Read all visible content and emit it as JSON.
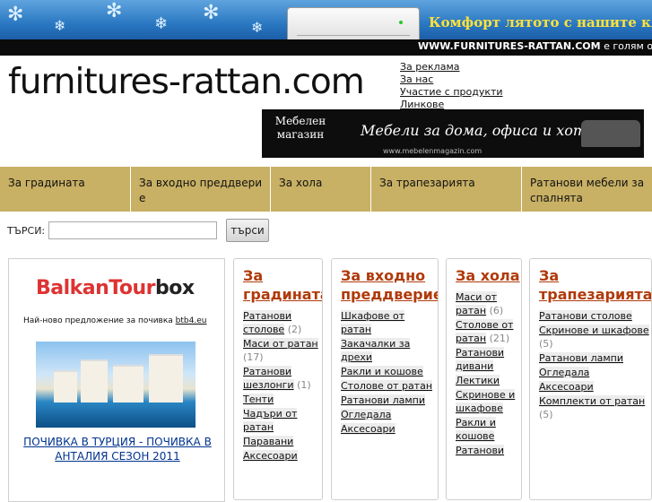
{
  "banner": {
    "promo_text": "Комфорт лятото с нашите клим",
    "site_bold": "WWW.FURNITURES-RATTAN.COM",
    "site_rest": " е голям онлай"
  },
  "header": {
    "logo_text": "furnitures-rattan.com",
    "top_links": [
      "За реклама",
      "За нас",
      "Участие с продукти",
      "Линкове"
    ]
  },
  "ad2": {
    "badge": "Мебелен магазин",
    "slogan": "Мебели за дома, офиса и хотела",
    "url": "www.mebelenmagazin.com"
  },
  "nav": {
    "tabs": [
      "За градината",
      "За входно преддвери е",
      "За хола",
      "За трапезарията",
      "Ратанови мебели за спалнята"
    ]
  },
  "search": {
    "label": "ТЪРСИ:",
    "value": "",
    "button": "търси"
  },
  "ad_box": {
    "brand_a": "BalkanTour",
    "brand_b": "box",
    "line_text": "Най-ново предложение за почивка ",
    "line_link": "btb4.eu",
    "caption": "ПОЧИВКА В ТУРЦИЯ - ПОЧИВКА В АНТАЛИЯ СЕЗОН 2011"
  },
  "columns": [
    {
      "title": "За градината",
      "items": [
        {
          "label": "Ратанови столове",
          "count": "(2)"
        },
        {
          "label": "Маси от ратан",
          "count": "(17)"
        },
        {
          "label": "Ратанови шезлонги",
          "count": "(1)"
        },
        {
          "label": "Тенти",
          "count": ""
        },
        {
          "label": "Чадъри от ратан",
          "count": ""
        },
        {
          "label": "Паравани",
          "count": ""
        },
        {
          "label": "Аксесоари",
          "count": ""
        }
      ]
    },
    {
      "title": "За входно преддверие",
      "items": [
        {
          "label": "Шкафове от ратан",
          "count": ""
        },
        {
          "label": "Закачалки за дрехи",
          "count": ""
        },
        {
          "label": "Ракли и кошове",
          "count": ""
        },
        {
          "label": "Столове от ратан",
          "count": ""
        },
        {
          "label": "Ратанови лампи",
          "count": ""
        },
        {
          "label": "Огледала",
          "count": ""
        },
        {
          "label": "Аксесоари",
          "count": ""
        }
      ]
    },
    {
      "title": "За хола",
      "items": [
        {
          "label": "Маси от ратан",
          "count": "(6)"
        },
        {
          "label": "Столове от ратан",
          "count": "(21)"
        },
        {
          "label": "Ратанови дивани",
          "count": ""
        },
        {
          "label": "Лектики",
          "count": ""
        },
        {
          "label": "Скринове и шкафове",
          "count": ""
        },
        {
          "label": "Ракли и кошове",
          "count": ""
        },
        {
          "label": "Ратанови",
          "count": ""
        }
      ]
    },
    {
      "title": "За трапезарията",
      "items": [
        {
          "label": "Ратанови столове",
          "count": ""
        },
        {
          "label": "Скринове и шкафове",
          "count": "(5)"
        },
        {
          "label": "Ратанови лампи",
          "count": ""
        },
        {
          "label": "Огледала",
          "count": ""
        },
        {
          "label": "Аксесоари",
          "count": ""
        },
        {
          "label": "Комплекти от ратан",
          "count": "(5)"
        }
      ]
    }
  ]
}
